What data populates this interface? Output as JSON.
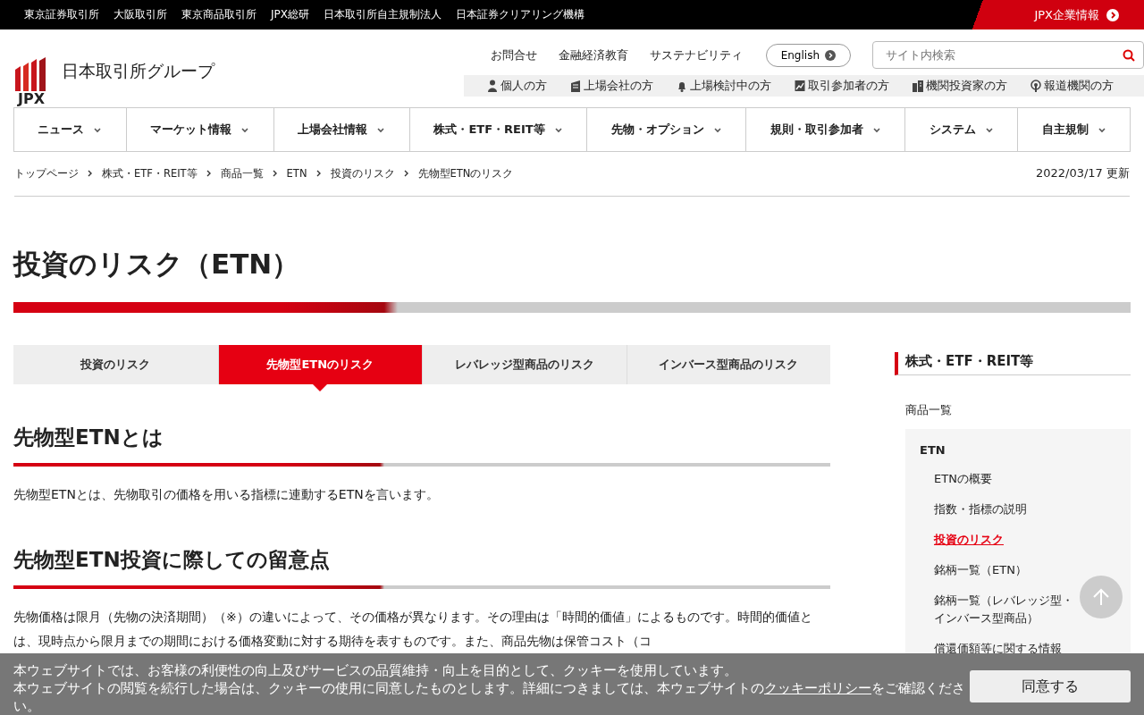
{
  "top_bar": {
    "links": [
      "東京証券取引所",
      "大阪取引所",
      "東京商品取引所",
      "JPX総研",
      "日本取引所自主規制法人",
      "日本証券クリアリング機構"
    ],
    "corporate_link": "JPX企業情報"
  },
  "header": {
    "logo_mark": "JPX",
    "logo_text": "日本取引所グループ",
    "utility_links": [
      "お問合せ",
      "金融経済教育",
      "サステナビリティ"
    ],
    "language_button": "English",
    "search": {
      "placeholder": "サイト内検索"
    },
    "audience_links": [
      {
        "kind": "person",
        "label": "個人の方"
      },
      {
        "kind": "building",
        "label": "上場会社の方"
      },
      {
        "kind": "bell",
        "label": "上場検討中の方"
      },
      {
        "kind": "chart",
        "label": "取引参加者の方"
      },
      {
        "kind": "phone",
        "label": "機関投資家の方"
      },
      {
        "kind": "signal",
        "label": "報道機関の方"
      }
    ]
  },
  "main_nav": [
    "ニュース",
    "マーケット情報",
    "上場会社情報",
    "株式・ETF・REIT等",
    "先物・オプション",
    "規則・取引参加者",
    "システム",
    "自主規制"
  ],
  "breadcrumb": [
    "トップページ",
    "株式・ETF・REIT等",
    "商品一覧",
    "ETN",
    "投資のリスク",
    "先物型ETNのリスク"
  ],
  "updated": "2022/03/17 更新",
  "page_title": "投資のリスク（ETN）",
  "tabs": [
    {
      "label": "投資のリスク",
      "selected": false
    },
    {
      "label": "先物型ETNのリスク",
      "selected": true
    },
    {
      "label": "レバレッジ型商品のリスク",
      "selected": false
    },
    {
      "label": "インバース型商品のリスク",
      "selected": false
    }
  ],
  "sections": [
    {
      "heading": "先物型ETNとは",
      "paragraphs": [
        "先物型ETNとは、先物取引の価格を用いる指標に連動するETNを言います。"
      ]
    },
    {
      "heading": "先物型ETN投資に際しての留意点",
      "paragraphs": [
        "先物価格は限月（先物の決済期間）（※）の違いによって、その価格が異なります。その理由は「時間的価値」によるものです。時間的価値とは、現時点から限月までの期間における価格変動に対する期待を表すものです。また、商品先物は保管コスト（コ"
      ]
    }
  ],
  "sidebar": {
    "title": "株式・ETF・REIT等",
    "parent": "商品一覧",
    "group": "ETN",
    "items": [
      {
        "label": "ETNの概要",
        "selected": false
      },
      {
        "label": "指数・指標の説明",
        "selected": false
      },
      {
        "label": "投資のリスク",
        "selected": true
      },
      {
        "label": "銘柄一覧（ETN）",
        "selected": false
      },
      {
        "label": "銘柄一覧（レバレッジ型・インバース型商品）",
        "selected": false
      },
      {
        "label": "償還価額等に関する情報",
        "selected": false
      }
    ]
  },
  "cookie_banner": {
    "lines": [
      "本ウェブサイトでは、お客様の利便性の向上及びサービスの品質維持・向上を目的として、クッキーを使用しています。",
      "本ウェブサイトの閲覧を続行した場合は、クッキーの使用に同意したものとします。詳細につきましては、本ウェブサイトの"
    ],
    "link": "クッキーポリシー",
    "tail": "をご確認ください。",
    "accept_button": "同意する"
  }
}
